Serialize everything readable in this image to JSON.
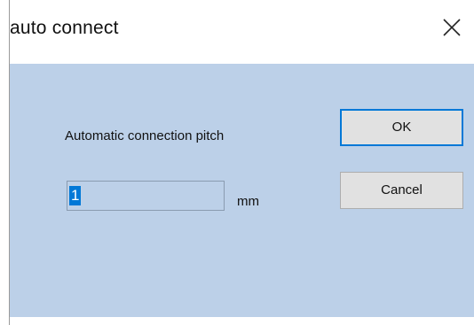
{
  "window": {
    "title": "auto connect",
    "close_icon": "close-icon"
  },
  "form": {
    "pitch_label": "Automatic connection pitch",
    "pitch_value": "1",
    "unit_label": "mm"
  },
  "buttons": {
    "ok_label": "OK",
    "cancel_label": "Cancel"
  },
  "colors": {
    "client_background": "#bcd0e8",
    "default_button_border": "#0078d7",
    "selection": "#0078d7"
  }
}
